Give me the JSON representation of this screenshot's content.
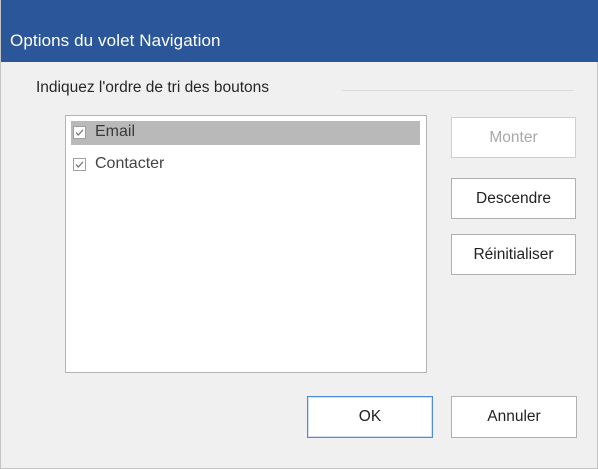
{
  "dialog": {
    "title": "Options du volet Navigation",
    "group_label": "Indiquez l'ordre de tri des boutons",
    "list_items": [
      {
        "label": "Email",
        "checked": true,
        "selected": true
      },
      {
        "label": "Contacter",
        "checked": true,
        "selected": false
      }
    ],
    "buttons": {
      "move_up": "Monter",
      "move_down": "Descendre",
      "reset": "Réinitialiser",
      "ok": "OK",
      "cancel": "Annuler"
    }
  },
  "colors": {
    "titlebar": "#2b579a",
    "selection": "#b9b9b9",
    "focus_border": "#4f8ad6"
  }
}
